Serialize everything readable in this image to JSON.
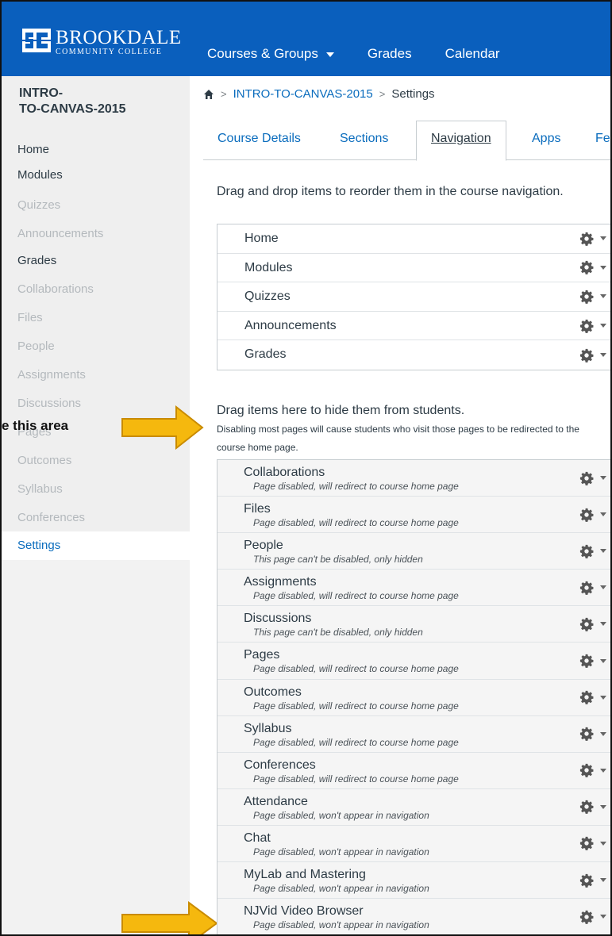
{
  "header": {
    "logo_name": "BROOKDALE",
    "logo_sub": "COMMUNITY COLLEGE",
    "nav": [
      {
        "label": "Courses & Groups"
      },
      {
        "label": "Grades"
      },
      {
        "label": "Calendar"
      }
    ],
    "color": "#0a5fbd"
  },
  "sidebar": {
    "course_name_line1": "INTRO-",
    "course_name_line2": "TO-CANVAS-2015",
    "items": [
      {
        "label": "Home",
        "enabled": true
      },
      {
        "label": "Modules",
        "enabled": true
      },
      {
        "label": "Quizzes",
        "enabled": false
      },
      {
        "label": "Announcements",
        "enabled": false
      },
      {
        "label": "Grades",
        "enabled": true
      },
      {
        "label": "Collaborations",
        "enabled": false
      },
      {
        "label": "Files",
        "enabled": false
      },
      {
        "label": "People",
        "enabled": false
      },
      {
        "label": "Assignments",
        "enabled": false
      },
      {
        "label": "Discussions",
        "enabled": false
      },
      {
        "label": "Pages",
        "enabled": false
      },
      {
        "label": "Outcomes",
        "enabled": false
      },
      {
        "label": "Syllabus",
        "enabled": false
      },
      {
        "label": "Conferences",
        "enabled": false
      }
    ],
    "settings_label": "Settings"
  },
  "callout": {
    "text": "e this area"
  },
  "breadcrumb": {
    "course": "INTRO-TO-CANVAS-2015",
    "current": "Settings"
  },
  "tabs": [
    {
      "label": "Course Details"
    },
    {
      "label": "Sections"
    },
    {
      "label": "Navigation",
      "selected": true
    },
    {
      "label": "Apps"
    },
    {
      "label": "Fe"
    }
  ],
  "instructions": "Drag and drop items to reorder them in the course navigation.",
  "visible_nav": [
    {
      "label": "Home"
    },
    {
      "label": "Modules"
    },
    {
      "label": "Quizzes"
    },
    {
      "label": "Announcements"
    },
    {
      "label": "Grades"
    }
  ],
  "hidden_section": {
    "title": "Drag items here to hide them from students.",
    "note": "Disabling most pages will cause students who visit those pages to be redirected to the course home page.",
    "items": [
      {
        "label": "Collaborations",
        "sub": "Page disabled, will redirect to course home page"
      },
      {
        "label": "Files",
        "sub": "Page disabled, will redirect to course home page"
      },
      {
        "label": "People",
        "sub": "This page can't be disabled, only hidden"
      },
      {
        "label": "Assignments",
        "sub": "Page disabled, will redirect to course home page"
      },
      {
        "label": "Discussions",
        "sub": "This page can't be disabled, only hidden"
      },
      {
        "label": "Pages",
        "sub": "Page disabled, will redirect to course home page"
      },
      {
        "label": "Outcomes",
        "sub": "Page disabled, will redirect to course home page"
      },
      {
        "label": "Syllabus",
        "sub": "Page disabled, will redirect to course home page"
      },
      {
        "label": "Conferences",
        "sub": "Page disabled, will redirect to course home page"
      },
      {
        "label": "Attendance",
        "sub": "Page disabled, won't appear in navigation"
      },
      {
        "label": "Chat",
        "sub": "Page disabled, won't appear in navigation"
      },
      {
        "label": "MyLab and Mastering",
        "sub": "Page disabled, won't appear in navigation"
      },
      {
        "label": "NJVid Video Browser",
        "sub": "Page disabled, won't appear in navigation"
      }
    ]
  },
  "colors": {
    "link": "#0a6cbd",
    "arrow": "#f5b80e",
    "arrow_stroke": "#c98b00"
  }
}
